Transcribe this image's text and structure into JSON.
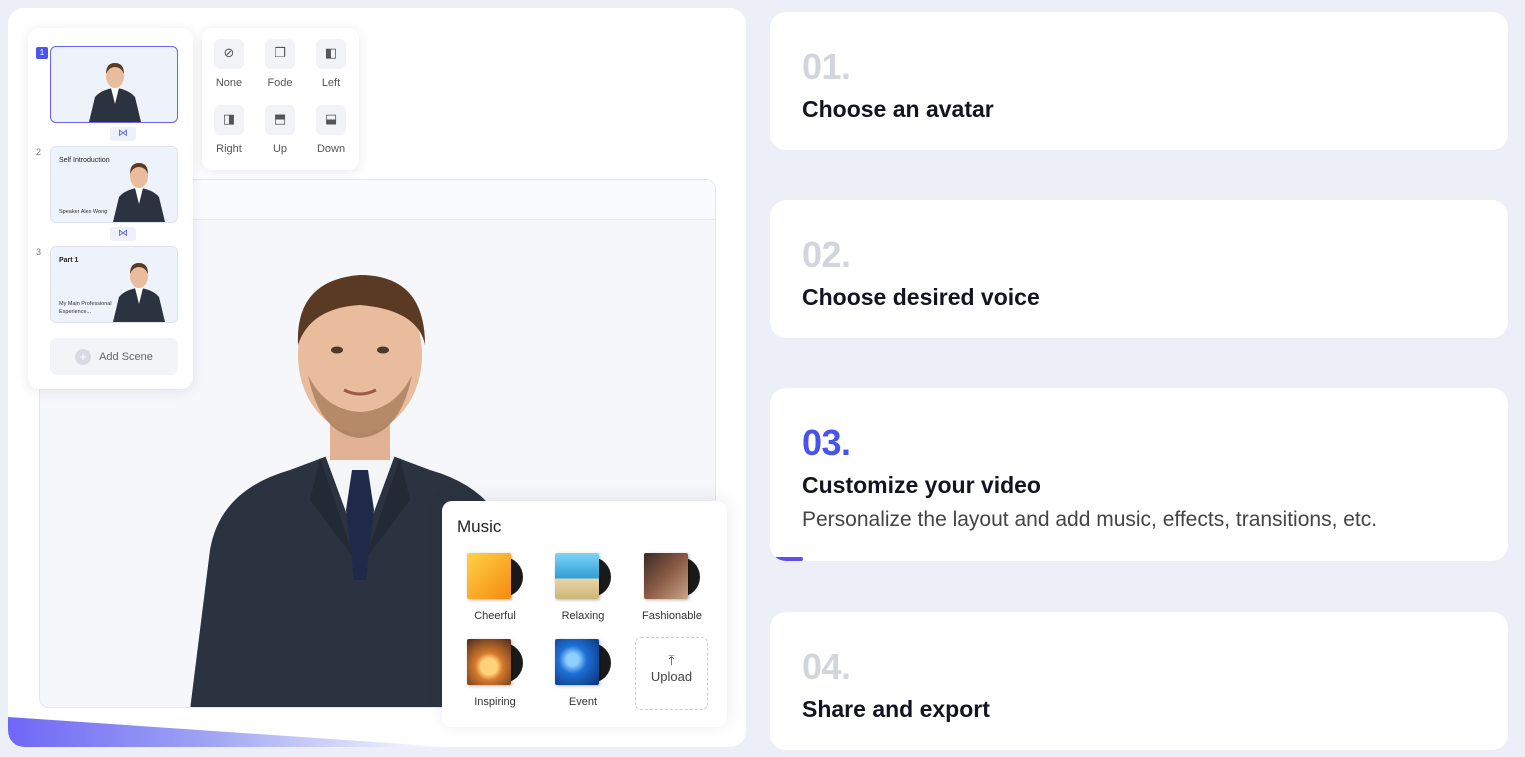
{
  "scenes": {
    "items": [
      {
        "number": "1",
        "title": "",
        "subtitle": ""
      },
      {
        "number": "2",
        "title": "Self Introduction",
        "subtitle": "Speaker Alex Wong"
      },
      {
        "number": "3",
        "title": "Part 1",
        "subtitle": "My Main Professional Experience..."
      }
    ],
    "add_label": "Add Scene"
  },
  "transitions": {
    "items": [
      {
        "label": "None",
        "icon": "none-circle-icon"
      },
      {
        "label": "Fode",
        "icon": "fade-copy-icon"
      },
      {
        "label": "Left",
        "icon": "slide-left-icon"
      },
      {
        "label": "Right",
        "icon": "slide-right-icon"
      },
      {
        "label": "Up",
        "icon": "slide-up-icon"
      },
      {
        "label": "Down",
        "icon": "slide-down-icon"
      }
    ]
  },
  "music": {
    "title": "Music",
    "tracks": [
      {
        "label": "Cheerful",
        "color": "#f7a21a"
      },
      {
        "label": "Relaxing",
        "color": "#4fb6e8"
      },
      {
        "label": "Fashionable",
        "color": "#6b4a3a"
      },
      {
        "label": "Inspiring",
        "color": "#c2672a"
      },
      {
        "label": "Event",
        "color": "#1d6fd6"
      }
    ],
    "upload_label": "Upload"
  },
  "steps": [
    {
      "number": "01.",
      "title": "Choose an avatar",
      "description": "",
      "active": false
    },
    {
      "number": "02.",
      "title": "Choose desired voice",
      "description": "",
      "active": false
    },
    {
      "number": "03.",
      "title": "Customize your video",
      "description": "Personalize the layout and add music, effects, transitions, etc.",
      "active": true,
      "progress": 0.045
    },
    {
      "number": "04.",
      "title": "Share and export",
      "description": "",
      "active": false
    }
  ],
  "colors": {
    "accent": "#4a52ee",
    "inactive_number": "#d3d5dc",
    "background": "#eceef8"
  }
}
